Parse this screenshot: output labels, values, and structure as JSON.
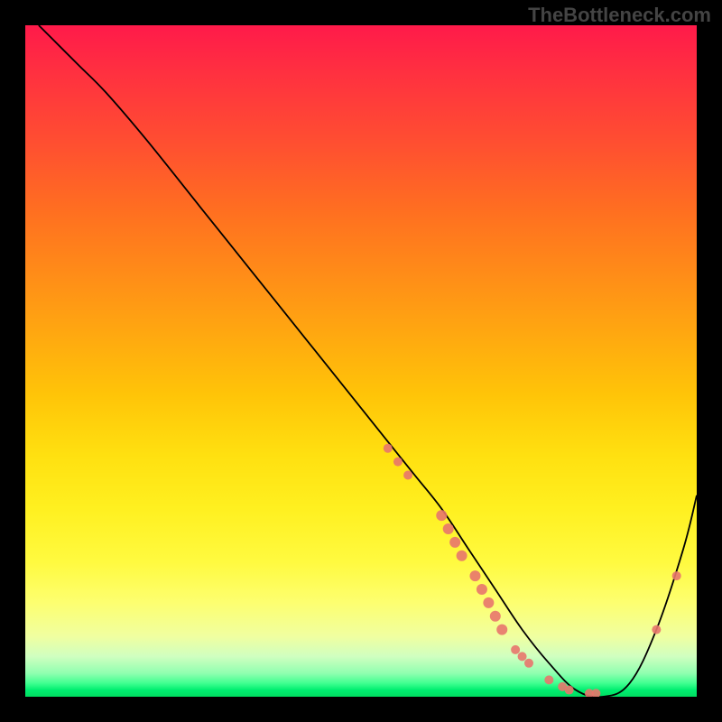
{
  "watermark": "TheBottleneck.com",
  "chart_data": {
    "type": "line",
    "title": "",
    "xlabel": "",
    "ylabel": "",
    "xlim": [
      0,
      100
    ],
    "ylim": [
      0,
      100
    ],
    "grid": false,
    "legend": false,
    "series": [
      {
        "name": "bottleneck-curve",
        "x": [
          2,
          5,
          8,
          12,
          18,
          26,
          34,
          42,
          50,
          54,
          58,
          62,
          66,
          70,
          74,
          78,
          82,
          86,
          90,
          94,
          98,
          100
        ],
        "y": [
          100,
          97,
          94,
          90,
          83,
          73,
          63,
          53,
          43,
          38,
          33,
          28,
          22,
          16,
          10,
          5,
          1,
          0,
          2,
          10,
          22,
          30
        ]
      }
    ],
    "scatter_points": {
      "name": "highlighted-points",
      "points": [
        {
          "x": 54,
          "y": 37,
          "r": 5
        },
        {
          "x": 55.5,
          "y": 35,
          "r": 5
        },
        {
          "x": 57,
          "y": 33,
          "r": 5
        },
        {
          "x": 62,
          "y": 27,
          "r": 6
        },
        {
          "x": 63,
          "y": 25,
          "r": 6
        },
        {
          "x": 64,
          "y": 23,
          "r": 6
        },
        {
          "x": 65,
          "y": 21,
          "r": 6
        },
        {
          "x": 67,
          "y": 18,
          "r": 6
        },
        {
          "x": 68,
          "y": 16,
          "r": 6
        },
        {
          "x": 69,
          "y": 14,
          "r": 6
        },
        {
          "x": 70,
          "y": 12,
          "r": 6
        },
        {
          "x": 71,
          "y": 10,
          "r": 6
        },
        {
          "x": 73,
          "y": 7,
          "r": 5
        },
        {
          "x": 74,
          "y": 6,
          "r": 5
        },
        {
          "x": 75,
          "y": 5,
          "r": 5
        },
        {
          "x": 78,
          "y": 2.5,
          "r": 5
        },
        {
          "x": 80,
          "y": 1.5,
          "r": 5
        },
        {
          "x": 81,
          "y": 1,
          "r": 5
        },
        {
          "x": 84,
          "y": 0.5,
          "r": 5
        },
        {
          "x": 85,
          "y": 0.5,
          "r": 5
        },
        {
          "x": 94,
          "y": 10,
          "r": 5
        },
        {
          "x": 97,
          "y": 18,
          "r": 5
        }
      ]
    },
    "background_gradient": {
      "top": "#ff1a4a",
      "mid": "#ffe010",
      "bottom": "#00dd60"
    }
  }
}
